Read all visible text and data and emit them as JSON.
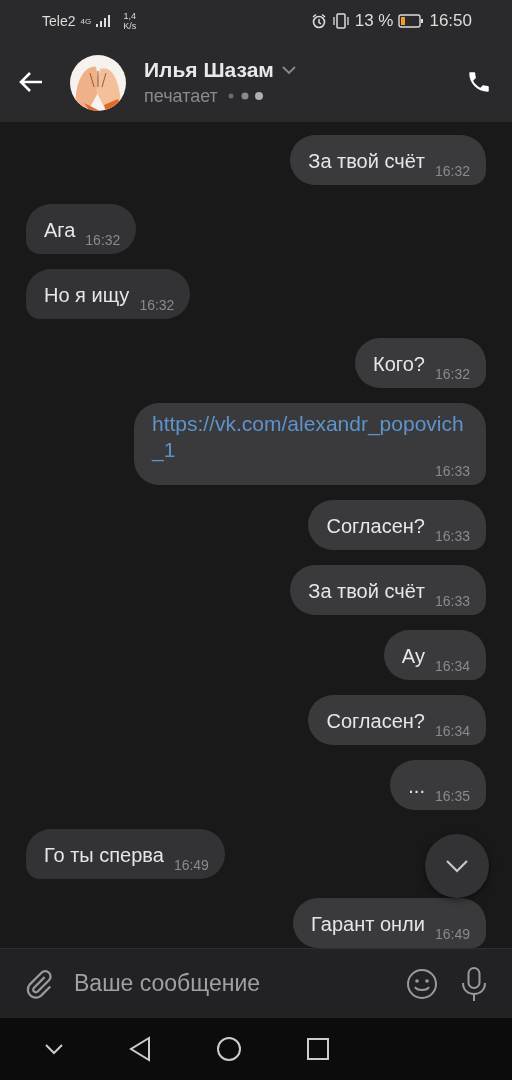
{
  "status_bar": {
    "carrier": "Tele2",
    "network": "4G",
    "speed_value": "1,4",
    "speed_unit": "K/s",
    "battery": "13 %",
    "time": "16:50"
  },
  "header": {
    "name": "Илья Шазам",
    "status": "печатает"
  },
  "messages": [
    {
      "outgoing": true,
      "kind": "text",
      "text": "За твой счёт",
      "time": "16:32"
    },
    {
      "outgoing": false,
      "kind": "text",
      "text": "Ага",
      "time": "16:32"
    },
    {
      "outgoing": false,
      "kind": "text",
      "text": "Но я ищу",
      "time": "16:32"
    },
    {
      "outgoing": true,
      "kind": "text",
      "text": "Кого?",
      "time": "16:32"
    },
    {
      "outgoing": true,
      "kind": "link",
      "text": "https://vk.com/alexandr_popovich_1",
      "time": "16:33"
    },
    {
      "outgoing": true,
      "kind": "text",
      "text": "Согласен?",
      "time": "16:33"
    },
    {
      "outgoing": true,
      "kind": "text",
      "text": "За твой счёт",
      "time": "16:33"
    },
    {
      "outgoing": true,
      "kind": "text",
      "text": "Ау",
      "time": "16:34"
    },
    {
      "outgoing": true,
      "kind": "text",
      "text": "Согласен?",
      "time": "16:34"
    },
    {
      "outgoing": true,
      "kind": "text",
      "text": "...",
      "time": "16:35"
    },
    {
      "outgoing": false,
      "kind": "text",
      "text": "Го ты сперва",
      "time": "16:49"
    },
    {
      "outgoing": true,
      "kind": "text",
      "text": "Гарант онли",
      "time": "16:49"
    }
  ],
  "composer": {
    "placeholder": "Ваше сообщение"
  }
}
